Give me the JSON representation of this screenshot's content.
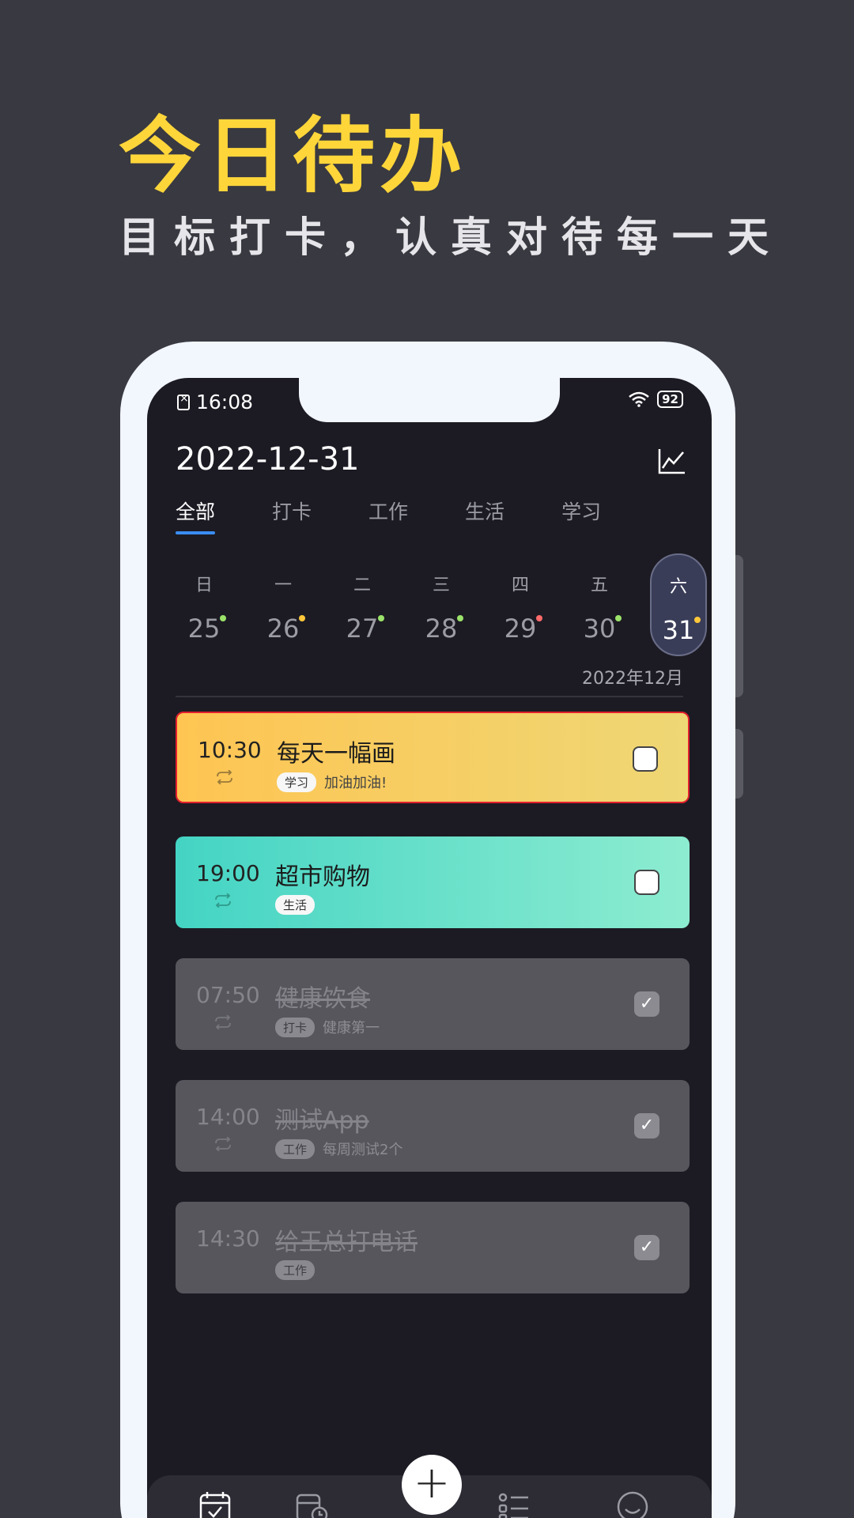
{
  "hero": {
    "title": "今日待办",
    "subtitle": "目标打卡，认真对待每一天"
  },
  "status": {
    "time": "16:08",
    "battery": "92"
  },
  "header": {
    "date": "2022-12-31"
  },
  "tabs": [
    "全部",
    "打卡",
    "工作",
    "生活",
    "学习"
  ],
  "week": [
    {
      "weekday": "日",
      "date": "25",
      "dot_color": "#9be36a"
    },
    {
      "weekday": "一",
      "date": "26",
      "dot_color": "#ffc83a"
    },
    {
      "weekday": "二",
      "date": "27",
      "dot_color": "#9be36a"
    },
    {
      "weekday": "三",
      "date": "28",
      "dot_color": "#9be36a"
    },
    {
      "weekday": "四",
      "date": "29",
      "dot_color": "#ff6b6b"
    },
    {
      "weekday": "五",
      "date": "30",
      "dot_color": "#9be36a"
    },
    {
      "weekday": "六",
      "date": "31",
      "dot_color": "#ffc83a",
      "selected": true
    }
  ],
  "month_label": "2022年12月",
  "tasks": [
    {
      "time": "10:30",
      "title": "每天一幅画",
      "tag": "学习",
      "note": "加油加油!",
      "done": false
    },
    {
      "time": "19:00",
      "title": "超市购物",
      "tag": "生活",
      "note": "",
      "done": false
    },
    {
      "time": "07:50",
      "title": "健康饮食",
      "tag": "打卡",
      "note": "健康第一",
      "done": true
    },
    {
      "time": "14:00",
      "title": "测试App",
      "tag": "工作",
      "note": "每周测试2个",
      "done": true
    },
    {
      "time": "14:30",
      "title": "给王总打电话",
      "tag": "工作",
      "note": "",
      "done": true
    }
  ],
  "fab_label": "+",
  "checkmark": "✓",
  "colors": {
    "accent": "#ffd63a",
    "tab_indicator": "#3b8ef5",
    "background": "#393941",
    "screen": "#1c1b23"
  },
  "bottom_nav": [
    "calendar-check-icon",
    "schedule-icon",
    "list-icon",
    "profile-icon"
  ]
}
